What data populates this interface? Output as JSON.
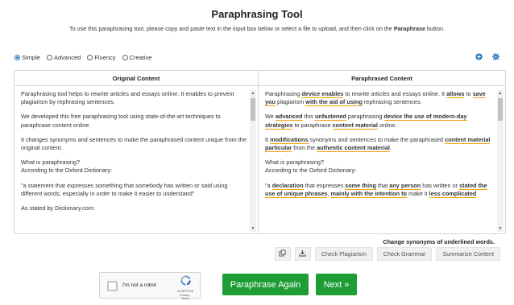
{
  "header": {
    "title": "Paraphrasing Tool",
    "subtitle_pre": "To use this paraphrasing tool, please copy and paste text in the input box below or select a file to upload, and then click on the ",
    "subtitle_bold": "Paraphrase",
    "subtitle_post": " button."
  },
  "modes": [
    {
      "label": "Simple",
      "checked": true
    },
    {
      "label": "Advanced",
      "checked": false
    },
    {
      "label": "Fluency",
      "checked": false
    },
    {
      "label": "Creative",
      "checked": false
    }
  ],
  "top_icons": [
    "plus-circle-icon",
    "settings-icon"
  ],
  "original": {
    "header": "Original Content",
    "paragraphs": [
      "Paraphrasing tool helps to rewrite articles and essays online. It enables to prevent plagiarism by rephrasing sentences.",
      "We developed this free paraphrasing tool using state-of-the-art techniques to paraphrase content online.",
      "It changes synonyms and sentences to make the paraphrased content unique from the original content.",
      "What is paraphrasing?\nAccording to the Oxford Dictionary:",
      "\"a statement that expresses something that somebody has written or said using different words, especially in order to make it easier to understand\"",
      "As stated by Dictionary.com:"
    ]
  },
  "paraphrased": {
    "header": "Paraphrased Content",
    "paragraphs": [
      [
        [
          "Paraphrasing ",
          false
        ],
        [
          "device enables",
          true
        ],
        [
          " to rewrite articles and essays online. It ",
          false
        ],
        [
          "allows",
          true
        ],
        [
          " to ",
          false
        ],
        [
          "save you",
          true
        ],
        [
          " plagiarism ",
          false
        ],
        [
          "with the aid of using",
          true
        ],
        [
          " rephrasing sentences.",
          false
        ]
      ],
      [
        [
          "We ",
          false
        ],
        [
          "advanced",
          true
        ],
        [
          " this ",
          false
        ],
        [
          "unfastened",
          true
        ],
        [
          " paraphrasing ",
          false
        ],
        [
          "device the use of modern-day strategies",
          true
        ],
        [
          " to paraphrase ",
          false
        ],
        [
          "content material",
          true
        ],
        [
          " online.",
          false
        ]
      ],
      [
        [
          "It ",
          false
        ],
        [
          "modifications",
          true
        ],
        [
          " synonyms and sentences to make the paraphrased ",
          false
        ],
        [
          "content material particular",
          true
        ],
        [
          " from the ",
          false
        ],
        [
          "authentic content material",
          true
        ],
        [
          ".",
          false
        ]
      ],
      [
        [
          "What is paraphrasing?\nAccording to the Oxford Dictionary:",
          false
        ]
      ],
      [
        [
          "\"a ",
          false
        ],
        [
          "declaration",
          true
        ],
        [
          " that expresses ",
          false
        ],
        [
          "some thing",
          true
        ],
        [
          " that ",
          false
        ],
        [
          "any person",
          true
        ],
        [
          " has written or ",
          false
        ],
        [
          "stated the use of unique phrases",
          true
        ],
        [
          ", ",
          false
        ],
        [
          "mainly with the intention to",
          true
        ],
        [
          " make it ",
          false
        ],
        [
          "less complicated",
          true
        ]
      ]
    ]
  },
  "hint": "Change synonyms of underlined words.",
  "actions": {
    "copy_icon": "copy-icon",
    "download_icon": "download-icon",
    "check_plagiarism": "Check Plagiarism",
    "check_grammar": "Check Grammar",
    "summarize": "Summarize Content"
  },
  "captcha": {
    "label": "I'm not a robot",
    "brand": "reCAPTCHA",
    "links": "Privacy - Terms"
  },
  "buttons": {
    "again": "Paraphrase Again",
    "next": "Next »"
  },
  "colors": {
    "accent": "#1e73be",
    "green": "#1f9d35",
    "underline": "#f0a000"
  }
}
